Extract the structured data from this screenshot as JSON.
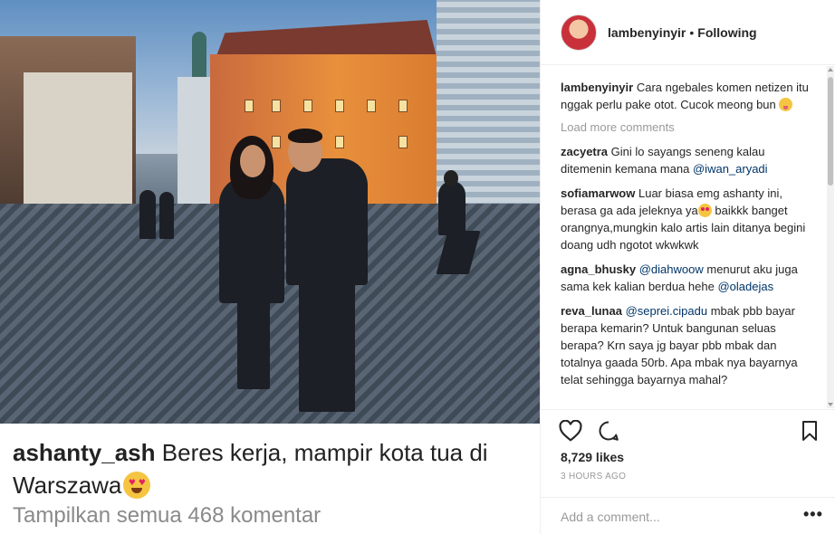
{
  "post": {
    "photo_alt": "",
    "caption_user": "ashanty_ash",
    "caption_text": "Beres kerja, mampir kota tua di Warszawa",
    "caption_emoji": "heart-eyes-emoji",
    "show_all_comments": "Tampilkan semua 468 komentar"
  },
  "header": {
    "username": "lambenyinyir",
    "separator": "•",
    "follow_status": "Following"
  },
  "main_comment": {
    "user": "lambenyinyir",
    "text": "Cara ngebales komen netizen itu nggak perlu pake otot. Cucok meong bun",
    "emoji": "tongue-out-emoji"
  },
  "load_more": "Load more comments",
  "comments": [
    {
      "user": "zacyetra",
      "text": "Gini lo sayangs seneng kalau ditemenin kemana mana",
      "mention": "@iwan_aryadi",
      "after": ""
    },
    {
      "user": "sofiamarwow",
      "text": "Luar biasa emg ashanty ini, berasa ga ada jeleknya ya",
      "mention": "",
      "after": "baikkk banget orangnya,mungkin kalo artis lain ditanya begini doang udh ngotot wkwkwk"
    },
    {
      "user": "agna_bhusky",
      "text": "",
      "mention": "@diahwoow",
      "after": "menurut aku juga sama kek kalian berdua hehe",
      "mention2": "@oladejas"
    },
    {
      "user": "reva_lunaa",
      "text": "",
      "mention": "@seprei.cipadu",
      "after": "mbak pbb bayar berapa kemarin? Untuk bangunan seluas berapa? Krn saya jg bayar pbb mbak dan totalnya gaada 50rb. Apa mbak nya bayarnya telat sehingga bayarnya mahal?"
    }
  ],
  "actions": {
    "likes": "8,729 likes",
    "time": "3 HOURS AGO",
    "add_comment_placeholder": "Add a comment...",
    "more": "•••"
  }
}
